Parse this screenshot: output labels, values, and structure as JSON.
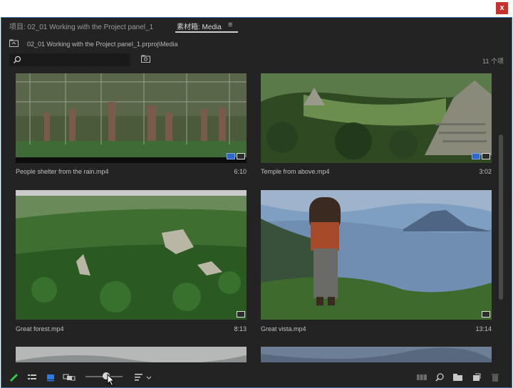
{
  "window": {
    "close_symbol": "x"
  },
  "tabs": [
    {
      "label": "项目: 02_01 Working with the Project panel_1",
      "active": false
    },
    {
      "label": "素材箱: Media",
      "active": true
    }
  ],
  "tab_menu_icon": "hamburger-menu-icon",
  "path": {
    "text": "02_01 Working with the Project panel_1.prproj\\Media"
  },
  "search": {
    "placeholder": "",
    "value": ""
  },
  "count": "11 个项",
  "clips": [
    {
      "name": "People shelter from the rain.mp4",
      "duration": "6:10",
      "badges": [
        "video-audio-badge-icon",
        "fit-badge-icon"
      ]
    },
    {
      "name": "Temple from above.mp4",
      "duration": "3:02",
      "badges": [
        "video-audio-badge-icon",
        "fit-badge-icon"
      ]
    },
    {
      "name": "Great forest.mp4",
      "duration": "8:13",
      "badges": [
        "fit-badge-icon"
      ]
    },
    {
      "name": "Great vista.mp4",
      "duration": "13:14",
      "badges": [
        "fit-badge-icon"
      ]
    },
    {
      "name": "",
      "duration": ""
    },
    {
      "name": "",
      "duration": ""
    }
  ],
  "toolbar": {
    "left_icons": [
      "pencil-icon",
      "list-view-icon",
      "icon-view-icon",
      "freeform-view-icon"
    ],
    "zoom_level": 0.55,
    "sort_icon": "sort-icon",
    "right_icons": [
      "automate-to-sequence-icon",
      "find-icon",
      "new-bin-icon",
      "new-item-icon",
      "clear-icon"
    ]
  },
  "colors": {
    "panel_bg": "#232323",
    "accent_blue": "#2f67c8",
    "close_red": "#c8312b",
    "pencil_green": "#2ecc40"
  }
}
